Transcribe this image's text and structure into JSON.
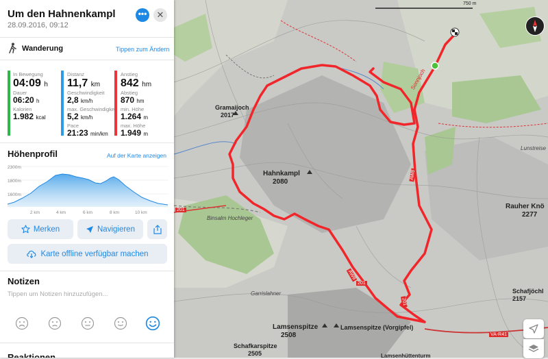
{
  "route": {
    "title": "Um den Hahnenkampl",
    "date": "28.09.2016, 09:12",
    "activity_type": "Wanderung",
    "change_type_link": "Tippen zum Ändern"
  },
  "stats": {
    "moving": {
      "label": "In Bewegung",
      "value": "04:09",
      "unit": "h"
    },
    "duration": {
      "label": "Dauer",
      "value": "06:20",
      "unit": "h"
    },
    "calories": {
      "label": "Kalorien",
      "value": "1.982",
      "unit": "kcal"
    },
    "distance": {
      "label": "Distanz",
      "value": "11,7",
      "unit": "km"
    },
    "avg_speed": {
      "label": "Geschwindigkeit",
      "value": "2,8",
      "unit": "km/h"
    },
    "max_speed": {
      "label": "max. Geschwindigkeit",
      "value": "5,2",
      "unit": "km/h"
    },
    "pace": {
      "label": "Pace",
      "value": "21:23",
      "unit": "min/km"
    },
    "ascent": {
      "label": "Anstieg",
      "value": "842",
      "unit": "hm"
    },
    "descent": {
      "label": "Abstieg",
      "value": "870",
      "unit": "hm"
    },
    "min_height": {
      "label": "min. Höhe",
      "value": "1.264",
      "unit": "m"
    },
    "max_height": {
      "label": "max. Höhe",
      "value": "1.949",
      "unit": "m"
    }
  },
  "colors": {
    "moving": "#2db84a",
    "distance": "#2f9be6",
    "ascent": "#e8363a",
    "accent": "#1e88e5",
    "route": "#f0262a"
  },
  "profile": {
    "heading": "Höhenprofil",
    "show_on_map_link": "Auf der Karte anzeigen",
    "y_labels": [
      "2300m",
      "1800m",
      "1600m"
    ],
    "x_labels": [
      "2 km",
      "4 km",
      "6 km",
      "8 km",
      "10 km"
    ]
  },
  "actions": {
    "save_label": "Merken",
    "navigate_label": "Navigieren",
    "offline_label": "Karte offline verfügbar machen"
  },
  "notes": {
    "heading": "Notizen",
    "placeholder": "Tippen um Notizen hinzuzufügen...",
    "next_heading": "Reaktionen"
  },
  "map": {
    "scale_label": "750 m",
    "labels": {
      "gramaijoch": "Gramaijoch",
      "gramaijoch_h": "2017",
      "hahnkampl": "Hahnkampl",
      "hahnkampl_h": "2080",
      "rauher": "Rauher Knö",
      "rauher_h": "2277",
      "lamsenspitze": "Lamsenspitze",
      "lamsenspitze_h": "2508",
      "vorgipfel": "Lamsenspitze (Vorgipfel)",
      "schafkarspitze": "Schafkarspitze",
      "schafkarspitze_h": "2505",
      "schafjochl": "Schafjöchl",
      "schafjochl_h": "2157",
      "garrislahner": "Garrislahner",
      "binsalm": "Binsalm Hochleger",
      "lunstreise": "Lunstreise",
      "lamsenhuette": "Lamsenhüttenturm",
      "sonnjoch_trail": "Sonnjoch"
    },
    "trail_badges": {
      "aw8": "AW8",
      "aw9": "AW9",
      "r201a": "201",
      "r201b": "201",
      "r201c": "201",
      "var41": "VA-R41"
    }
  }
}
